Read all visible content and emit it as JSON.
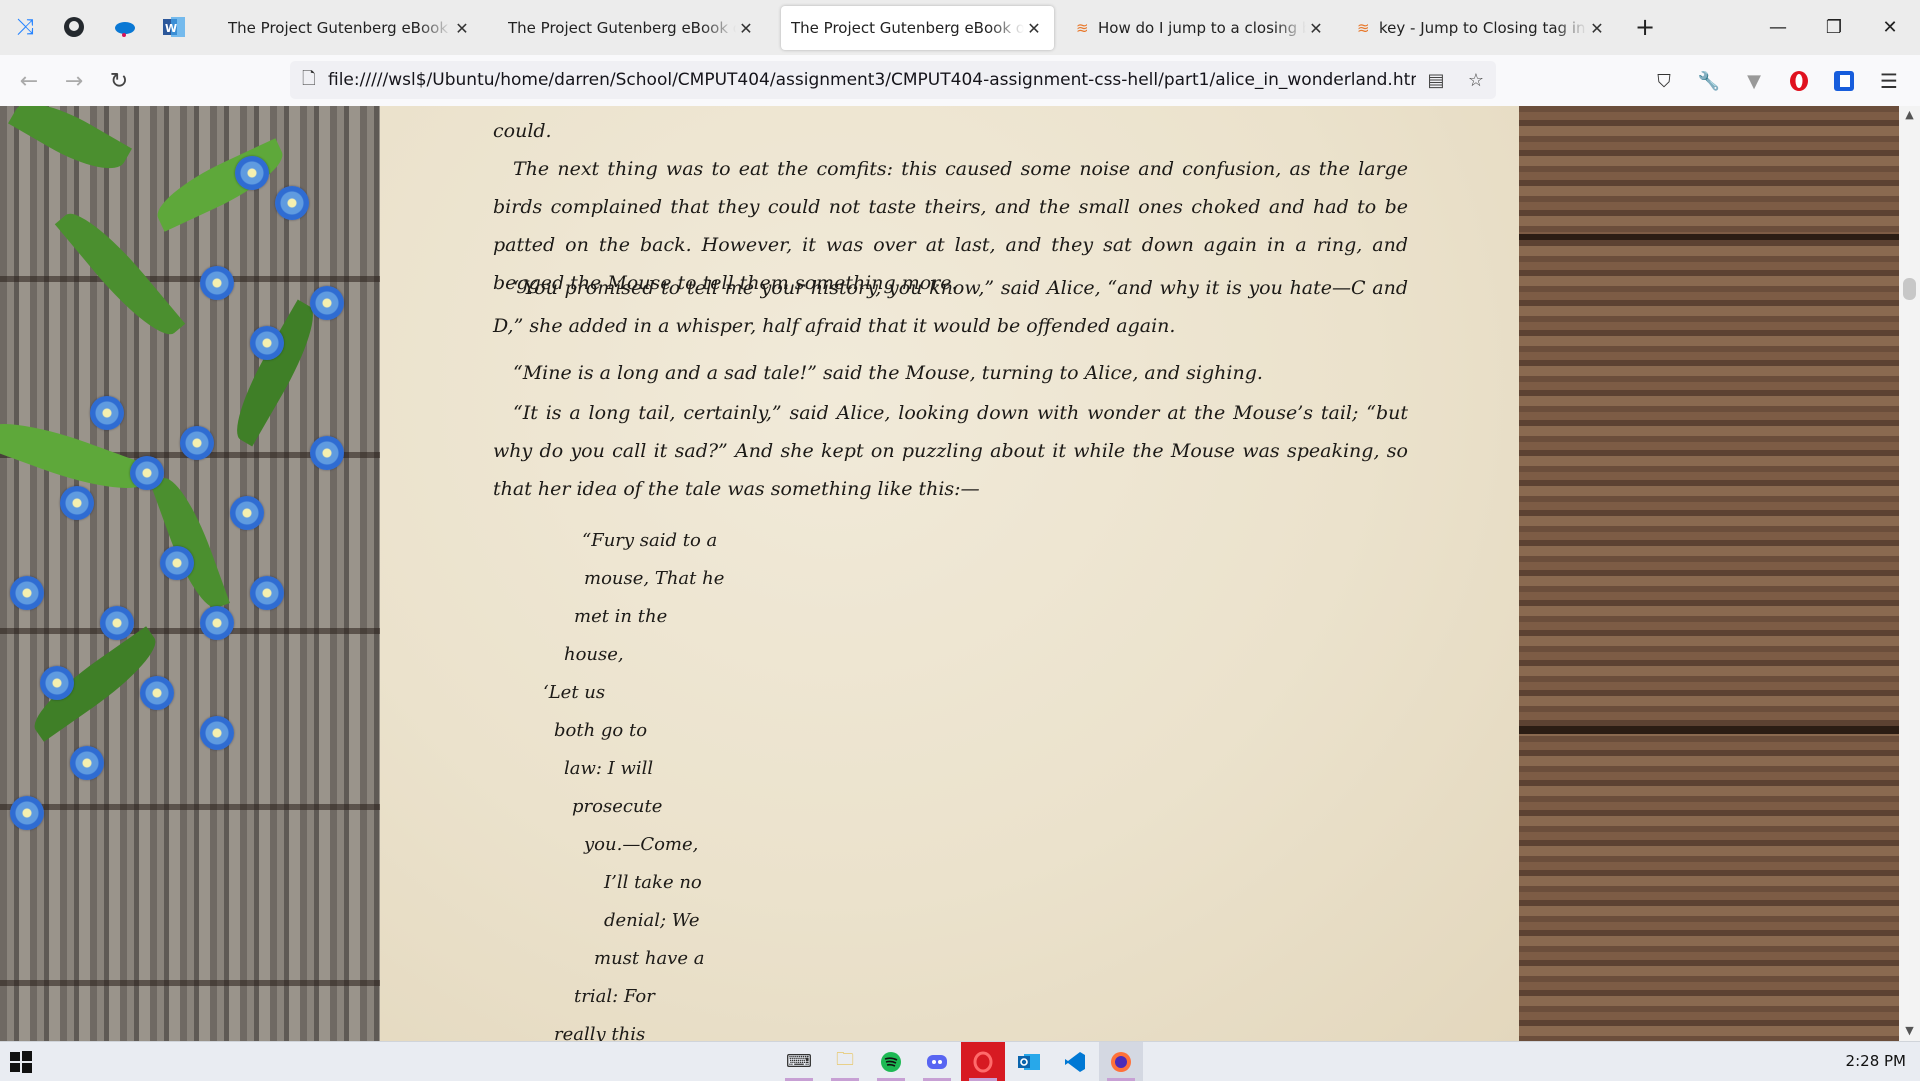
{
  "tabs": [
    {
      "title": "The Project Gutenberg eBook of Fra",
      "active": false
    },
    {
      "title": "The Project Gutenberg eBook of Pri",
      "active": false
    },
    {
      "title": "The Project Gutenberg eBook of Ali",
      "active": true
    },
    {
      "title": "How do I jump to a closing bra",
      "active": false
    },
    {
      "title": "key - Jump to Closing tag in VS",
      "active": false
    }
  ],
  "tab_close_glyph": "✕",
  "new_tab_glyph": "+",
  "window": {
    "minimize": "—",
    "restore": "❐",
    "close": "✕"
  },
  "nav": {
    "back": "←",
    "forward": "→",
    "reload": "↻"
  },
  "address_bar": {
    "url": "file://///wsl$/Ubuntu/home/darren/School/CMPUT404/assignment3/CMPUT404-assignment-css-hell/part1/alice_in_wonderland.html"
  },
  "toolbar_icons": [
    "pocket-icon",
    "wrench-icon",
    "extension-icon",
    "opera-icon",
    "bitwarden-icon",
    "menu-icon"
  ],
  "content": {
    "fragment_top": "could.",
    "paragraphs": [
      "The next thing was to eat the comfits: this caused some noise and confusion, as the large birds complained that they could not taste theirs, and the small ones choked and had to be patted on the back. However, it was over at last, and they sat down again in a ring, and begged the Mouse to tell them something more.",
      "“You promised to tell me your history, you know,” said Alice, “and why it is you hate—C and D,” she added in a whisper, half afraid that it would be offended again.",
      "“Mine is a long and a sad tale!” said the Mouse, turning to Alice, and sighing.",
      "“It is a long tail, certainly,” said Alice, looking down with wonder at the Mouse’s tail; “but why do you call it sad?” And she kept on puzzling about it while the Mouse was speaking, so that her idea of the tale was something like this:—"
    ],
    "tail_lines": [
      "“Fury said to a",
      "mouse, That he",
      "met in the",
      "house,",
      "‘Let us",
      "both go to",
      "law: I will",
      "prosecute",
      "you.—Come,",
      "I’ll take no",
      "denial; We",
      "must have a",
      "trial: For",
      "really this"
    ]
  },
  "taskbar": {
    "apps": [
      "terminal-icon",
      "file-explorer-icon",
      "spotify-icon",
      "discord-icon",
      "opera-icon",
      "outlook-icon",
      "vscode-icon",
      "firefox-icon"
    ],
    "clock": "2:28 PM"
  }
}
